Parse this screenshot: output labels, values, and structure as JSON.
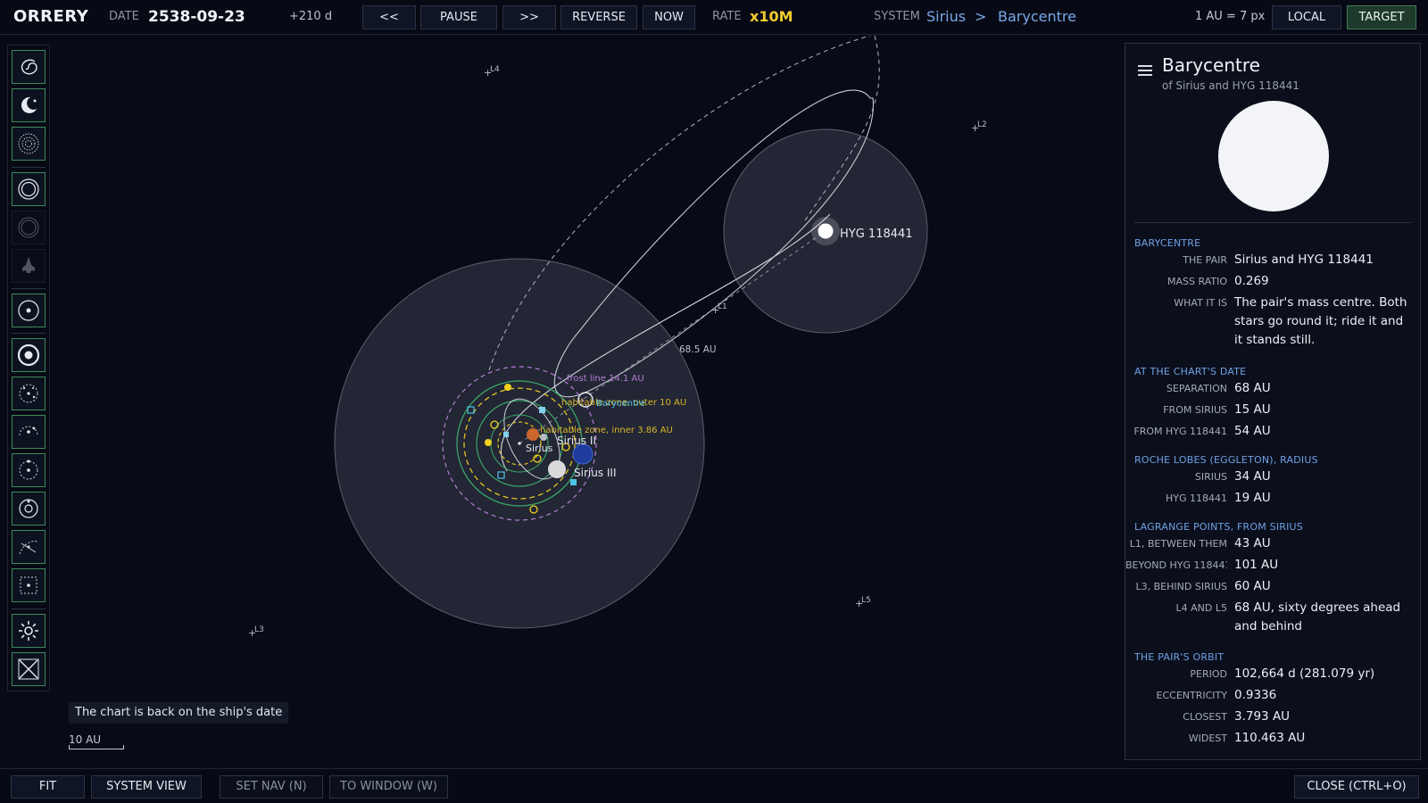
{
  "app": {
    "title": "ORRERY"
  },
  "topbar": {
    "date_label": "DATE",
    "date_value": "2538-09-23",
    "offset": "+210 d",
    "btn_back": "<<",
    "btn_pause": "PAUSE",
    "btn_forward": ">>",
    "btn_reverse": "REVERSE",
    "btn_now": "NOW",
    "rate_label": "RATE",
    "rate_value": "x10M",
    "system_label": "SYSTEM",
    "system_name": "Sirius",
    "breadcrumb_sep": ">",
    "system_target": "Barycentre",
    "scale": "1 AU = 7 px",
    "btn_local": "LOCAL",
    "btn_target": "TARGET"
  },
  "toolbar": {
    "tools": [
      {
        "icon": "galaxy-icon",
        "active": true
      },
      {
        "icon": "crescent-icon",
        "active": true
      },
      {
        "icon": "rings-dotted-icon",
        "active": true
      },
      {
        "icon": "orbit-ring-icon",
        "active": true
      },
      {
        "icon": "faint-ring-icon",
        "active": false
      },
      {
        "icon": "ship-icon",
        "active": false
      },
      {
        "icon": "target-orbit-icon",
        "active": true
      },
      {
        "icon": "bullseye-icon",
        "active": true
      },
      {
        "icon": "scatter-dots-icon",
        "active": true
      },
      {
        "icon": "arc-dots-icon",
        "active": true
      },
      {
        "icon": "orbit-dot-icon",
        "active": true
      },
      {
        "icon": "concentric-icon",
        "active": true
      },
      {
        "icon": "trajectory-icon",
        "active": true
      },
      {
        "icon": "square-orbit-icon",
        "active": true
      },
      {
        "icon": "settings-gear-icon",
        "active": true
      },
      {
        "icon": "close-x-icon",
        "active": true
      }
    ]
  },
  "chart": {
    "lagrange": [
      "L1",
      "L2",
      "L3",
      "L4",
      "L5"
    ],
    "hyg_label": "HYG 118441",
    "separation_label": "68.5 AU",
    "frost_line": "frost line  14.1 AU",
    "hz_outer": "habitable zone, outer  10 AU",
    "hz_inner": "habitable zone, inner  3.86 AU",
    "barycentre_label": "Barycentre",
    "sirius_label": "Sirius",
    "sirius2_label": "Sirius II",
    "sirius3_label": "Sirius III",
    "toast": "The chart is back on the ship's date",
    "scale_bar": "10 AU",
    "colors": {
      "orbit": "#c8ccd6",
      "frost": "#b37ed6",
      "hz": "#e1c321",
      "planet_orbit": "#3aa56a",
      "hz_label": "#d9b62a",
      "cyan": "#4fc3e6"
    }
  },
  "panel": {
    "title": "Barycentre",
    "subtitle": "of Sirius and HYG 118441",
    "sections": [
      {
        "heading": "BARYCENTRE",
        "rows": [
          {
            "k": "THE PAIR",
            "v": "Sirius and HYG 118441"
          },
          {
            "k": "MASS RATIO",
            "v": "0.269"
          },
          {
            "k": "WHAT IT IS",
            "v": "The pair's mass centre. Both stars go round it; ride it and it stands still."
          }
        ]
      },
      {
        "heading": "AT THE CHART'S DATE",
        "rows": [
          {
            "k": "SEPARATION",
            "v": "68 AU"
          },
          {
            "k": "FROM SIRIUS",
            "v": "15 AU"
          },
          {
            "k": "FROM HYG 118441",
            "v": "54 AU"
          }
        ]
      },
      {
        "heading": "ROCHE LOBES (EGGLETON), RADIUS",
        "rows": [
          {
            "k": "SIRIUS",
            "v": "34 AU"
          },
          {
            "k": "HYG 118441",
            "v": "19 AU"
          }
        ]
      },
      {
        "heading": "LAGRANGE POINTS, FROM SIRIUS",
        "rows": [
          {
            "k": "L1, BETWEEN THEM",
            "v": "43 AU"
          },
          {
            "k": "BEYOND HYG 118441",
            "v": "101 AU"
          },
          {
            "k": "L3, BEHIND SIRIUS",
            "v": "60 AU"
          },
          {
            "k": "L4 AND L5",
            "v": "68 AU, sixty degrees ahead and behind"
          }
        ]
      },
      {
        "heading": "THE PAIR'S ORBIT",
        "rows": [
          {
            "k": "PERIOD",
            "v": "102,664 d  (281.079 yr)"
          },
          {
            "k": "ECCENTRICITY",
            "v": "0.9336"
          },
          {
            "k": "CLOSEST",
            "v": "3.793 AU"
          },
          {
            "k": "WIDEST",
            "v": "110.463 AU"
          }
        ]
      }
    ]
  },
  "bottombar": {
    "fit": "FIT",
    "system_view": "SYSTEM VIEW",
    "set_nav": "SET NAV (N)",
    "to_window": "TO WINDOW (W)",
    "close": "CLOSE (CTRL+O)"
  }
}
